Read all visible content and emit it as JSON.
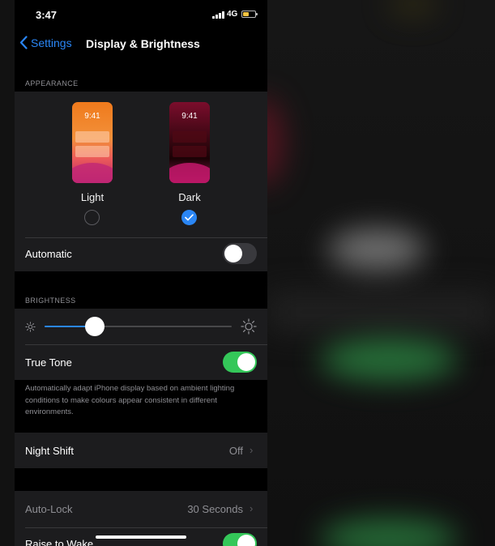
{
  "status_bar": {
    "time": "3:47",
    "network": "4G"
  },
  "nav": {
    "back_label": "Settings",
    "title": "Display & Brightness"
  },
  "appearance": {
    "section_label": "APPEARANCE",
    "thumb_time": "9:41",
    "light_label": "Light",
    "dark_label": "Dark",
    "selected": "Dark",
    "automatic_label": "Automatic",
    "automatic_on": false
  },
  "brightness": {
    "section_label": "BRIGHTNESS",
    "level": 0.27,
    "true_tone_label": "True Tone",
    "true_tone_on": true,
    "footnote": "Automatically adapt iPhone display based on ambient lighting conditions to make colours appear consistent in different environments."
  },
  "night_shift": {
    "label": "Night Shift",
    "value": "Off"
  },
  "auto_lock": {
    "label": "Auto-Lock",
    "value": "30 Seconds"
  },
  "raise_to_wake": {
    "label": "Raise to Wake",
    "on": true
  },
  "colors": {
    "accent": "#2a86f5",
    "toggle_on": "#34c759",
    "cell_bg": "#1c1c1e"
  }
}
